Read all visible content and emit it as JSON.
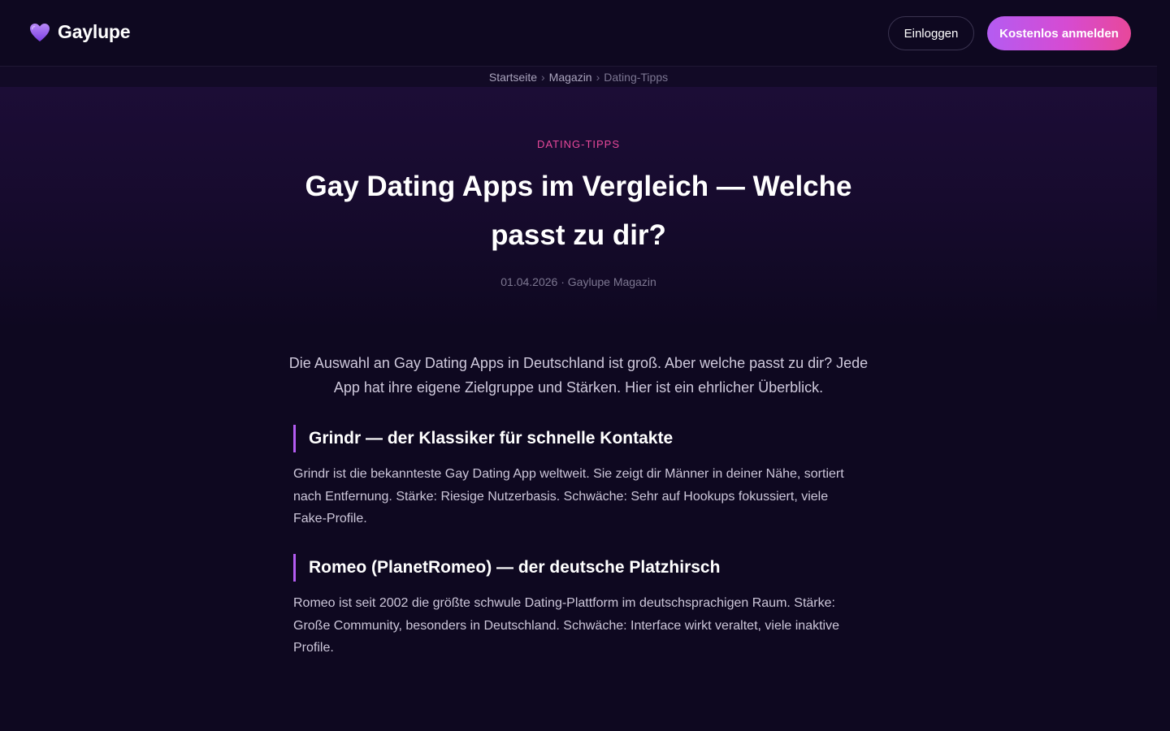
{
  "header": {
    "brand_name": "Gaylupe",
    "brand_icon": "purple-heart-icon",
    "login_label": "Einloggen",
    "signup_label": "Kostenlos anmelden"
  },
  "breadcrumb": {
    "items": [
      "Startseite",
      "Magazin",
      "Dating-Tipps"
    ],
    "separator": "›"
  },
  "article": {
    "category": "DATING-TIPPS",
    "title": "Gay Dating Apps im Vergleich — Welche passt zu dir?",
    "date": "01.04.2026",
    "meta_separator": "·",
    "author": "Gaylupe Magazin",
    "intro": "Die Auswahl an Gay Dating Apps in Deutschland ist groß. Aber welche passt zu dir? Jede App hat ihre eigene Zielgruppe und Stärken. Hier ist ein ehrlicher Überblick.",
    "sections": [
      {
        "heading": "Grindr — der Klassiker für schnelle Kontakte",
        "body": "Grindr ist die bekannteste Gay Dating App weltweit. Sie zeigt dir Männer in deiner Nähe, sortiert nach Entfernung. Stärke: Riesige Nutzerbasis. Schwäche: Sehr auf Hookups fokussiert, viele Fake-Profile."
      },
      {
        "heading": "Romeo (PlanetRomeo) — der deutsche Platzhirsch",
        "body": "Romeo ist seit 2002 die größte schwule Dating-Plattform im deutschsprachigen Raum. Stärke: Große Community, besonders in Deutschland. Schwäche: Interface wirkt veraltet, viele inaktive Profile."
      }
    ]
  },
  "colors": {
    "background": "#0e0820",
    "accent_purple": "#b45cf2",
    "accent_pink": "#e8489a"
  }
}
